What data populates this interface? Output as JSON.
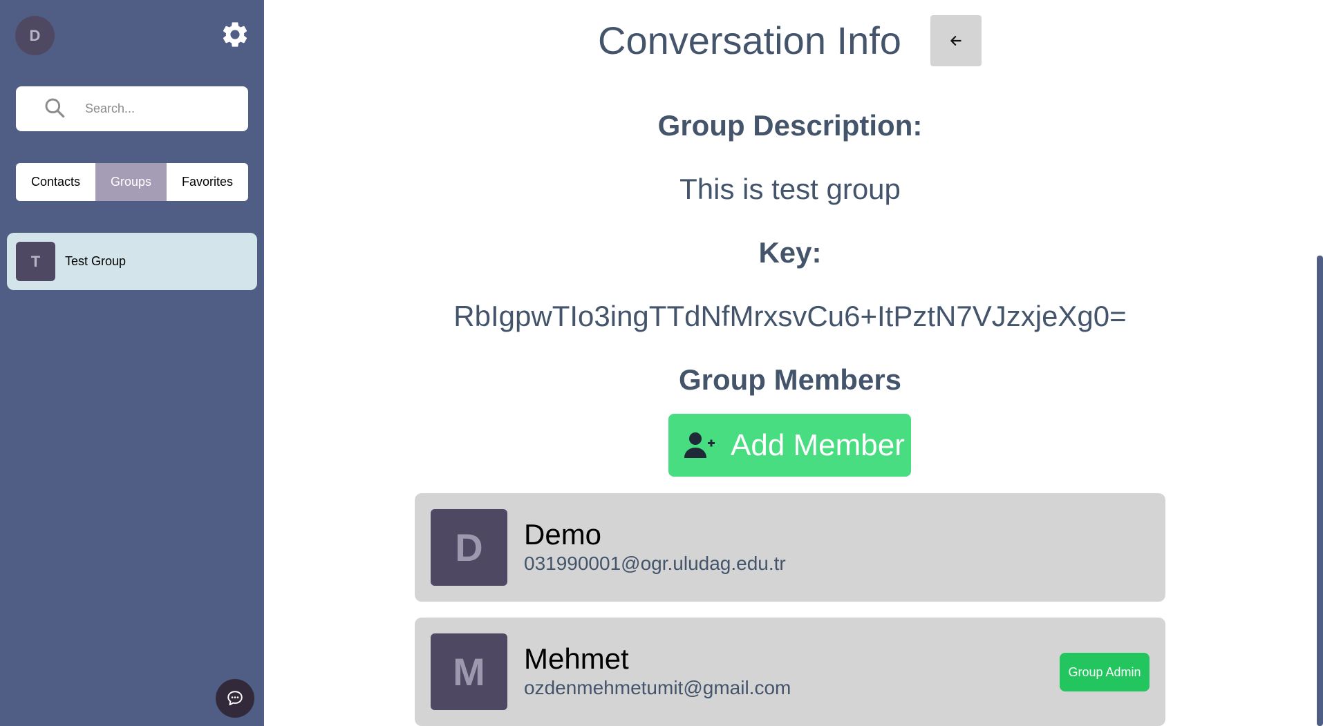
{
  "sidebar": {
    "user_avatar_letter": "D",
    "search": {
      "placeholder": "Search..."
    },
    "tabs": [
      {
        "label": "Contacts",
        "active": false
      },
      {
        "label": "Groups",
        "active": true
      },
      {
        "label": "Favorites",
        "active": false
      }
    ],
    "groups": [
      {
        "avatar_letter": "T",
        "name": "Test Group"
      }
    ]
  },
  "main": {
    "title": "Conversation Info",
    "description_label": "Group Description:",
    "description_value": "This is test group",
    "key_label": "Key:",
    "key_value": "RbIgpwTIo3ingTTdNfMrxsvCu6+ItPztN7VJzxjeXg0=",
    "members_label": "Group Members",
    "add_member_label": "Add Member",
    "members": [
      {
        "avatar_letter": "D",
        "name": "Demo",
        "email": "031990001@ogr.uludag.edu.tr",
        "badge": ""
      },
      {
        "avatar_letter": "M",
        "name": "Mehmet",
        "email": "ozdenmehmetumit@gmail.com",
        "badge": "Group Admin"
      }
    ]
  },
  "colors": {
    "sidebar_bg": "#505e86",
    "active_tab": "#a59db6",
    "selected_group_bg": "#d3e4ea",
    "avatar_bg": "#4f4862",
    "add_member_green": "#48dd80",
    "admin_badge_green": "#22c55e",
    "text_slate": "#44546b"
  },
  "icons": [
    "gear-icon",
    "search-icon",
    "arrow-left-icon",
    "user-plus-icon",
    "chat-bubble-icon"
  ]
}
